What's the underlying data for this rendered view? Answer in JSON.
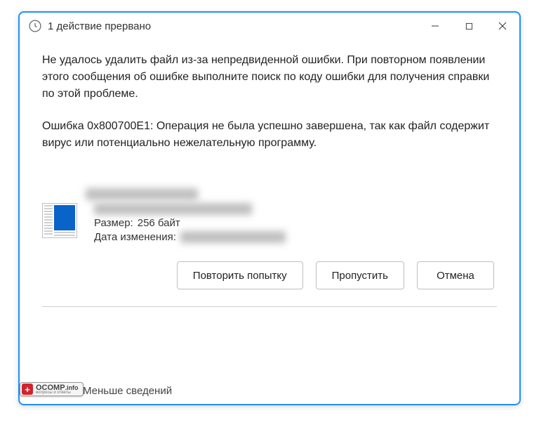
{
  "title": "1 действие прервано",
  "message1": "Не удалось удалить файл из-за непредвиденной ошибки. При повторном появлении этого сообщения об ошибке выполните поиск по коду ошибки для получения справки по этой проблеме.",
  "message2": "Ошибка 0x800700E1: Операция не была успешно завершена, так как файл содержит вирус или потенциально нежелательную программу.",
  "file": {
    "size_label": "Размер:",
    "size_value": "256 байт",
    "date_label": "Дата изменения:"
  },
  "buttons": {
    "retry": "Повторить попытку",
    "skip": "Пропустить",
    "cancel": "Отмена"
  },
  "footer": {
    "less_details": "Меньше сведений"
  },
  "badge": {
    "brand": "OCOMP",
    "tld": ".info",
    "tagline": "вопросы и ответы"
  }
}
